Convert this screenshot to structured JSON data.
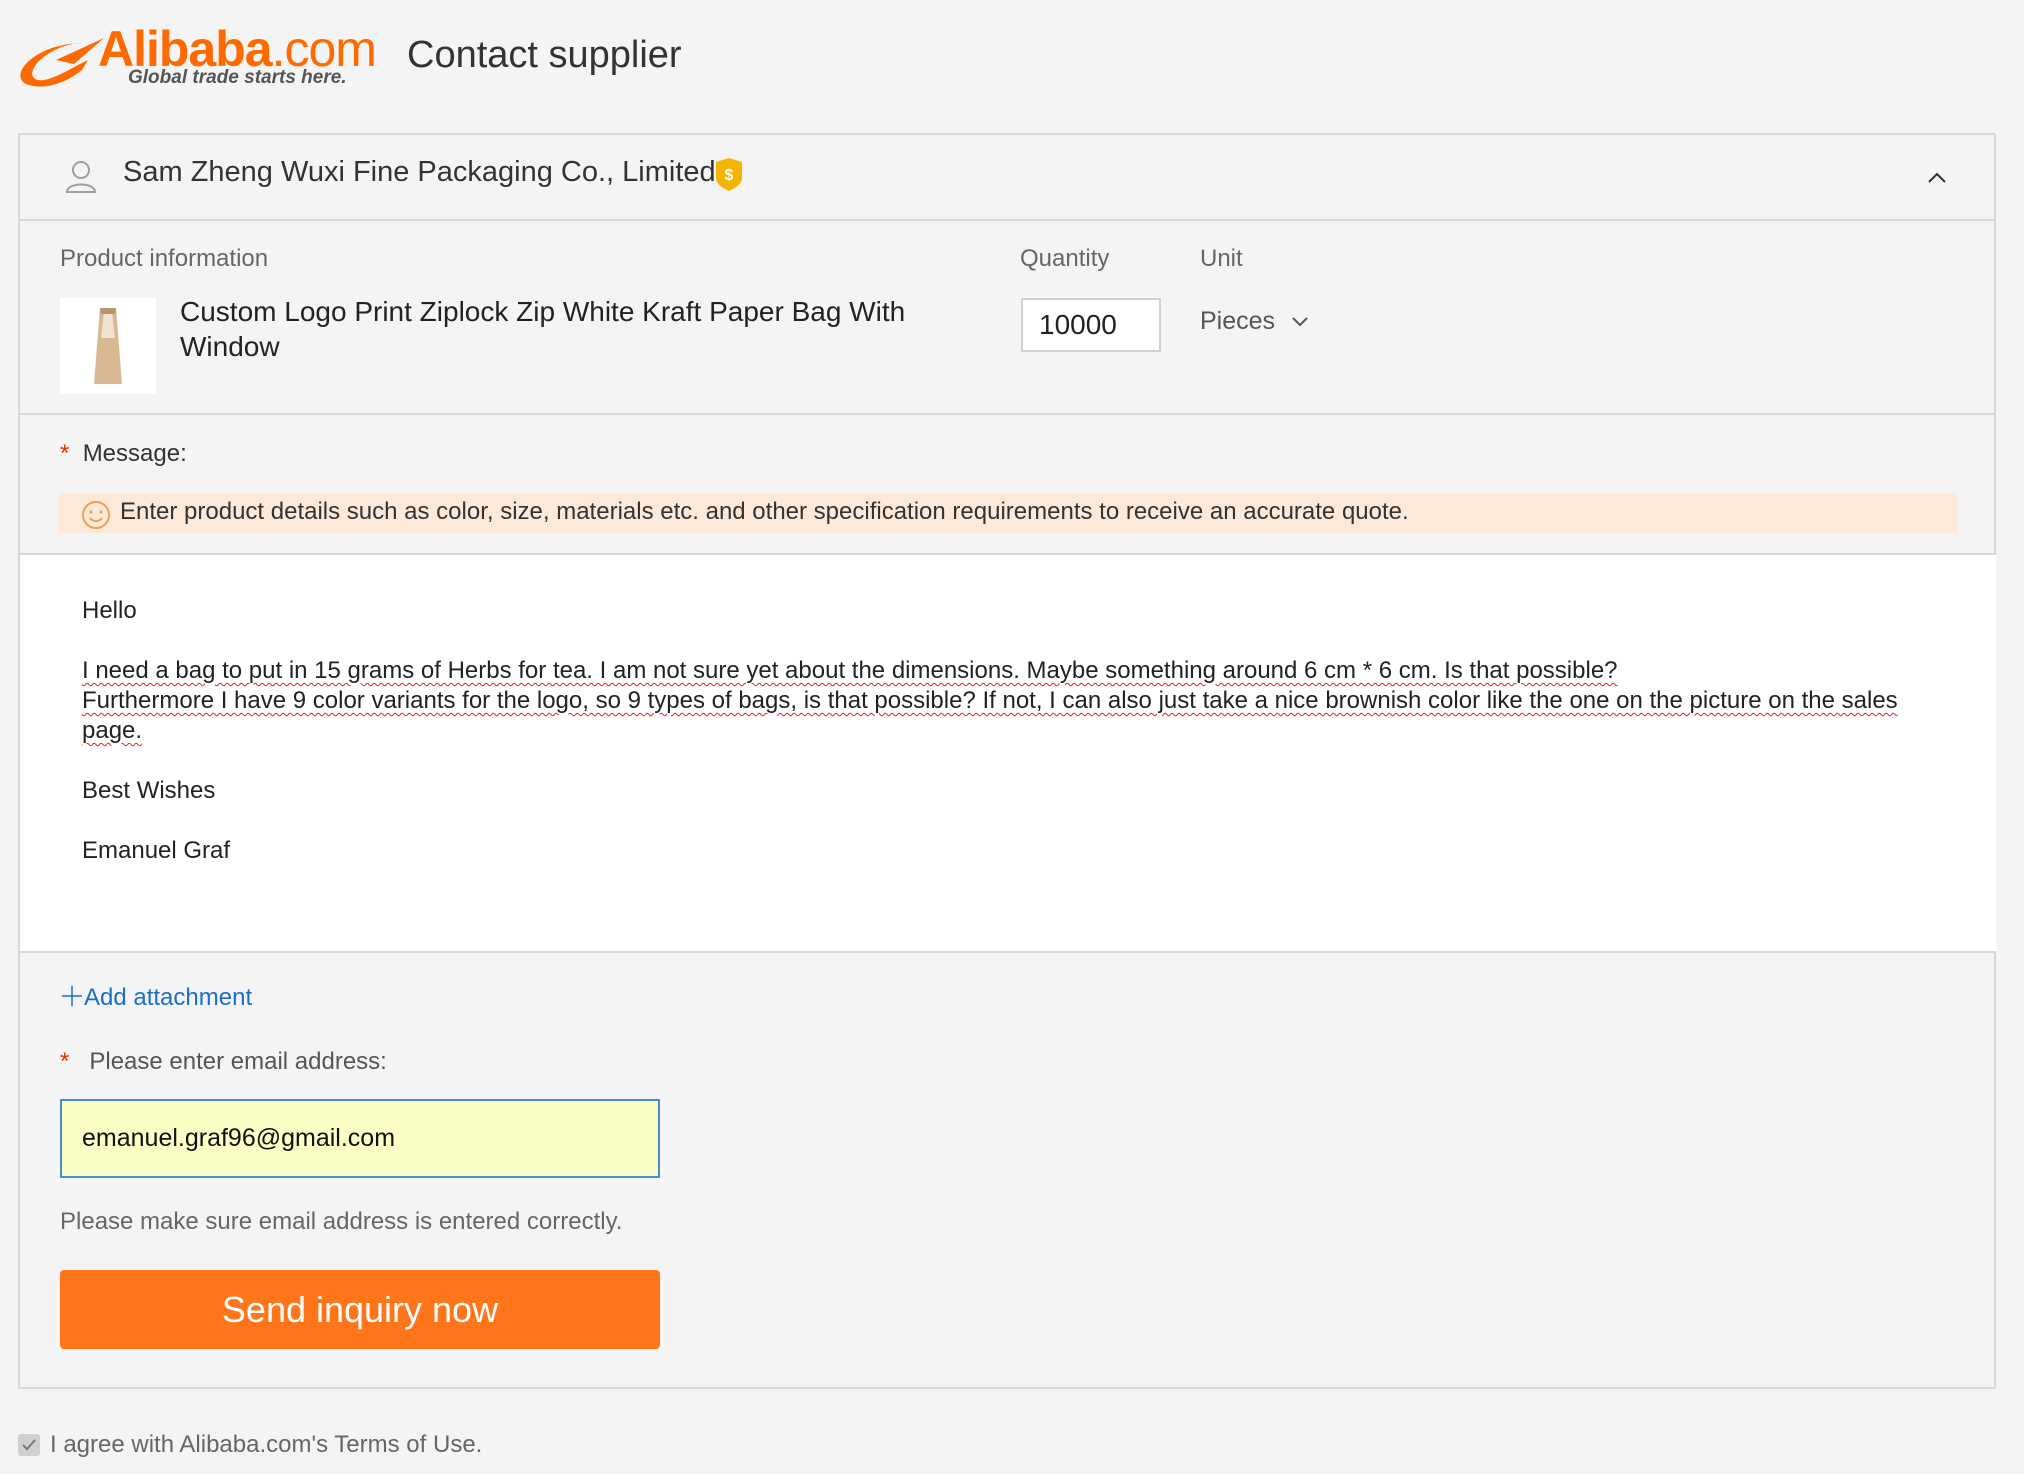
{
  "header": {
    "logo_brand": "Alibaba",
    "logo_tld": ".com",
    "logo_tagline": "Global trade starts here.",
    "page_title": "Contact supplier"
  },
  "supplier": {
    "name": "Sam Zheng Wuxi Fine Packaging Co., Limited",
    "user_icon": "user-icon",
    "badge_icon": "gold-supplier-shield-icon",
    "collapse_icon": "chevron-up-icon"
  },
  "product": {
    "section_label": "Product information",
    "title": "Custom Logo Print Ziplock Zip White Kraft Paper Bag With Window",
    "quantity_label": "Quantity",
    "quantity_value": "10000",
    "unit_label": "Unit",
    "unit_value": "Pieces"
  },
  "message": {
    "required_mark": "*",
    "label": "Message:",
    "tip_icon": "smiley-icon",
    "tip": "Enter product details such as color, size, materials etc. and other specification requirements to receive an accurate quote.",
    "lines": [
      "Hello",
      "",
      "I need a bag to put in 15 grams of Herbs for tea. I am not sure yet about the dimensions. Maybe something around 6 cm * 6 cm. Is that possible?",
      "Furthermore I have 9 color variants for the logo, so 9 types of bags, is that possible? If not, I can also just take a nice brownish color like the one on the picture on the sales",
      "page.",
      "",
      "Best Wishes",
      "",
      "Emanuel Graf"
    ]
  },
  "attachment": {
    "label": "Add attachment"
  },
  "email": {
    "required_mark": "*",
    "label": "Please enter email address:",
    "value": "emanuel.graf96@gmail.com",
    "hint": "Please make sure email address is entered correctly."
  },
  "send_button": "Send inquiry now",
  "terms": {
    "text": "I agree with Alibaba.com's Terms of Use.",
    "checked": true
  },
  "colors": {
    "accent": "#ff6a00",
    "button": "#ff7519",
    "link": "#1a6fc4",
    "required": "#e62e04"
  }
}
